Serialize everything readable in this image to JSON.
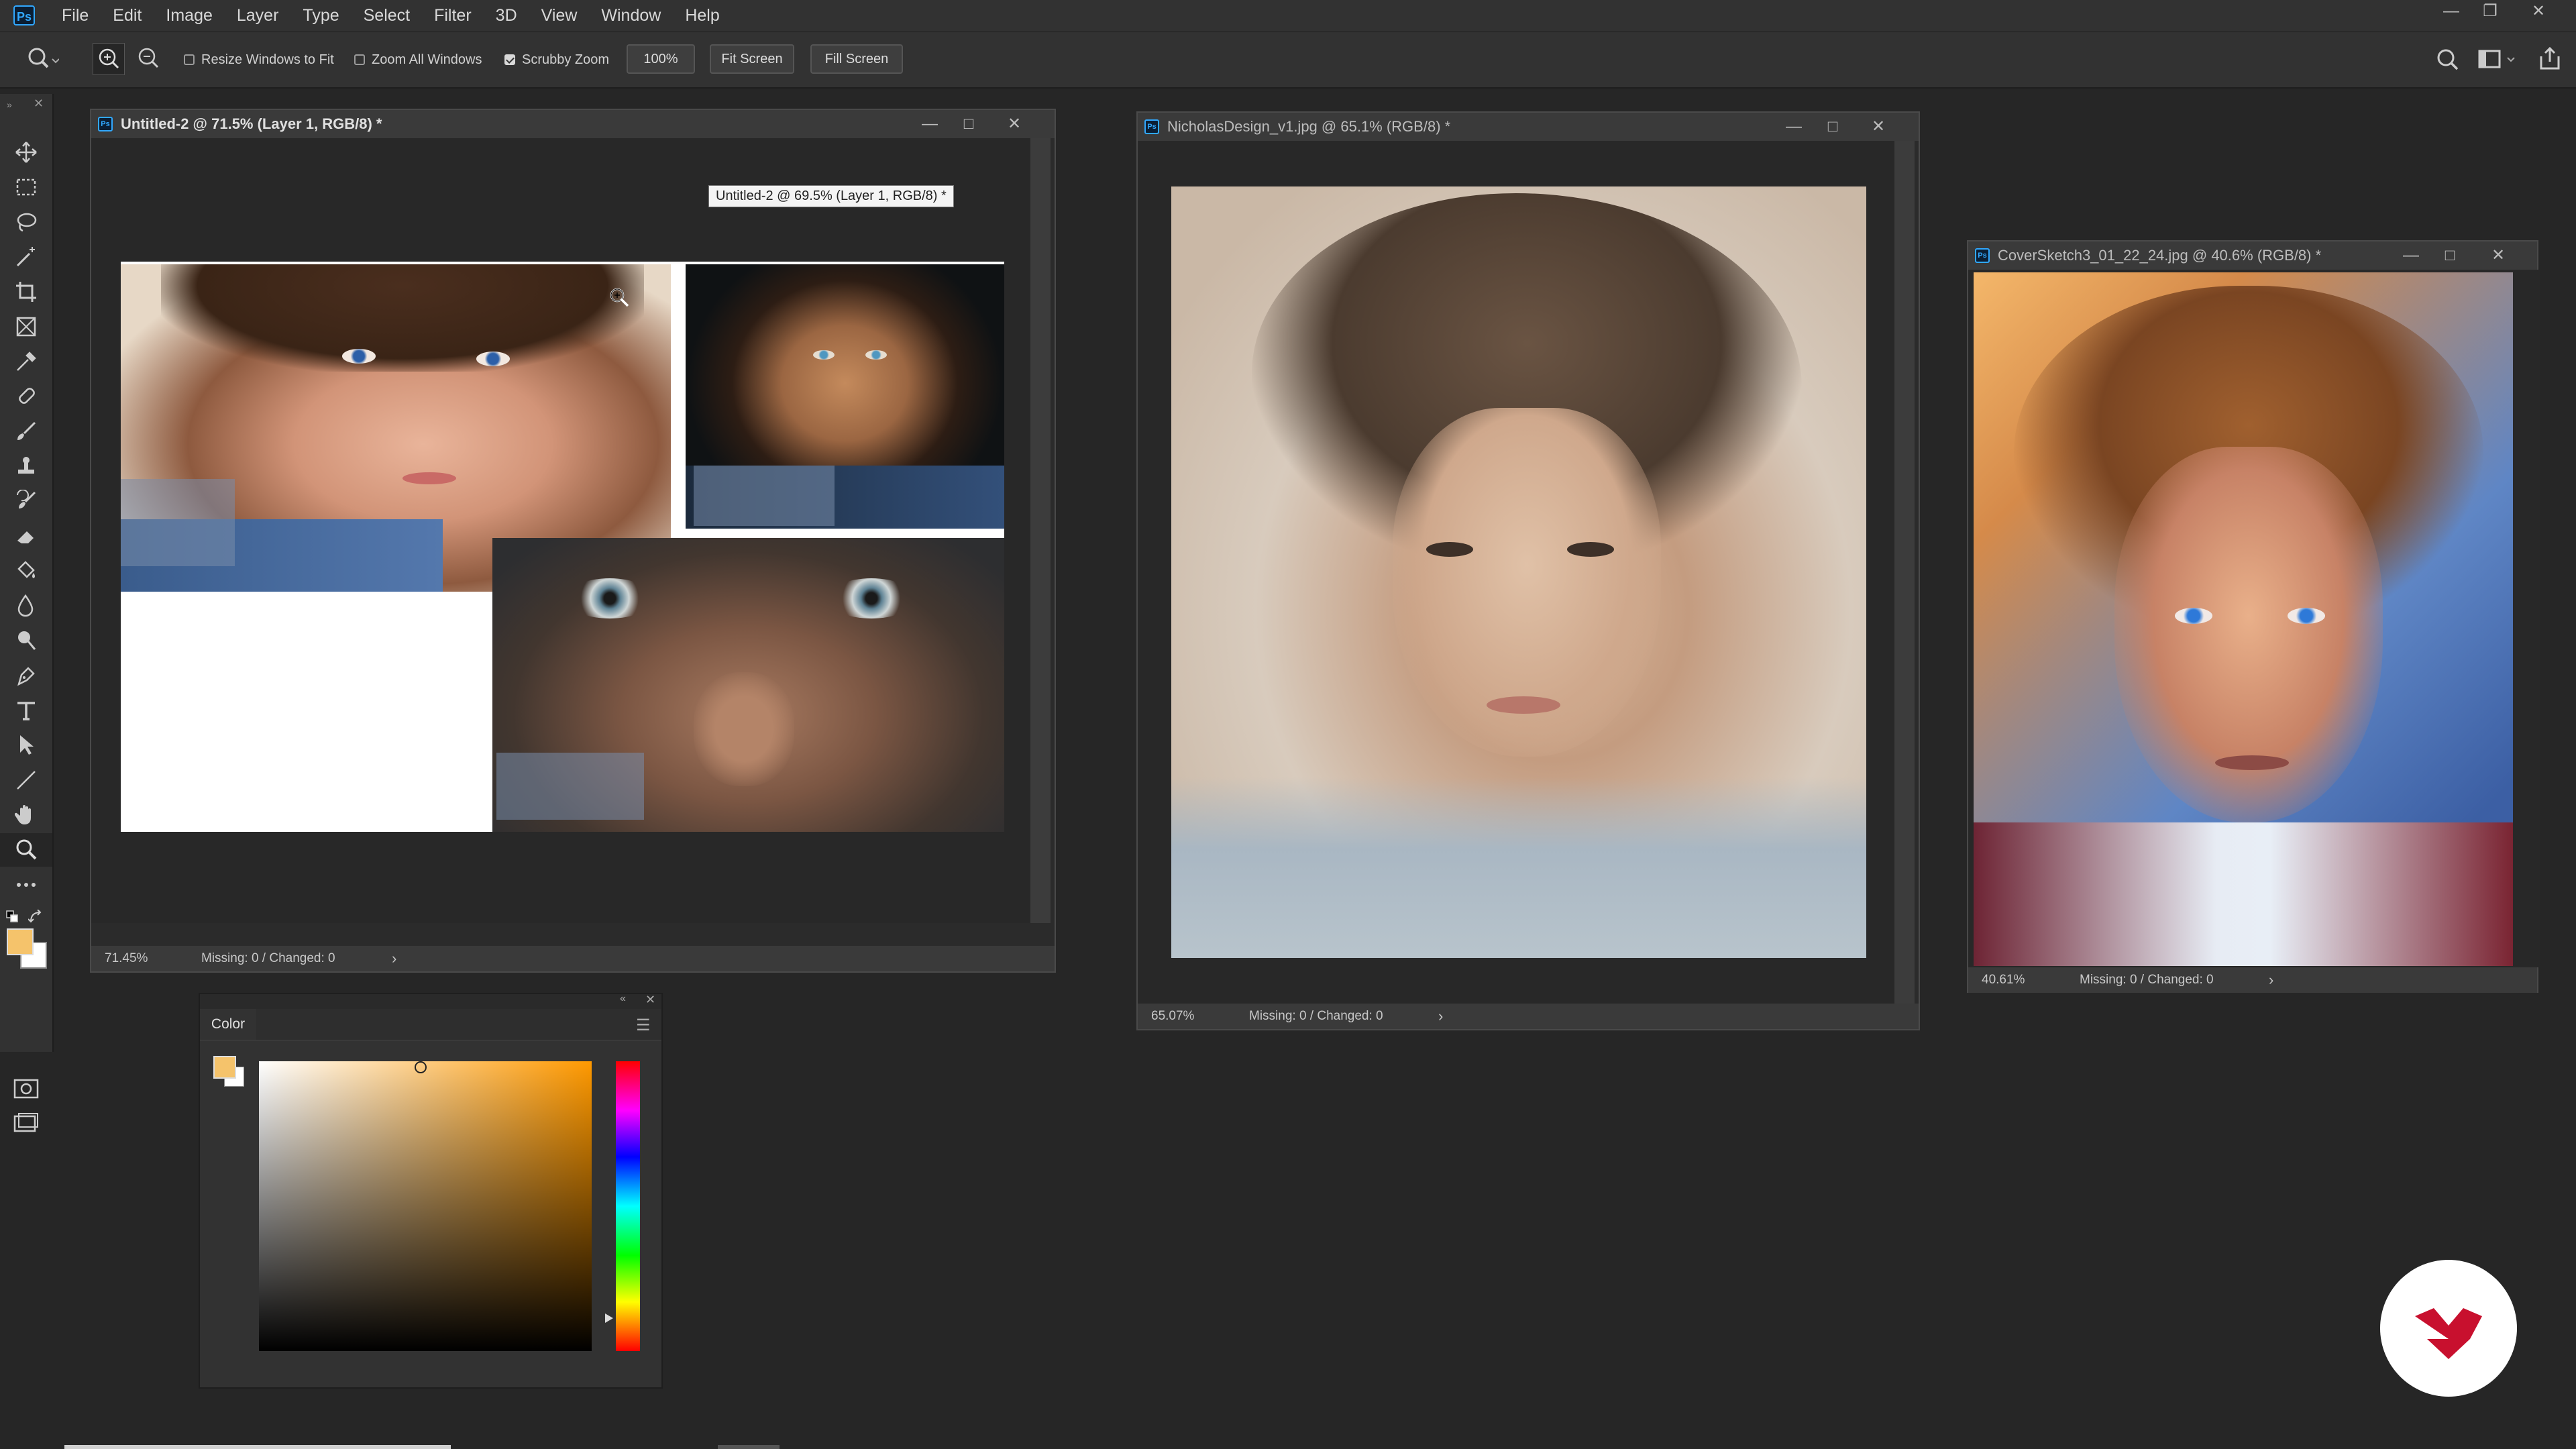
{
  "app": {
    "logo_text": "Ps"
  },
  "menubar": {
    "items": [
      "File",
      "Edit",
      "Image",
      "Layer",
      "Type",
      "Select",
      "Filter",
      "3D",
      "View",
      "Window",
      "Help"
    ]
  },
  "options": {
    "resize_windows": "Resize Windows to Fit",
    "zoom_all": "Zoom All Windows",
    "scrubby_zoom": "Scrubby Zoom",
    "zoom_value": "100%",
    "fit_screen": "Fit Screen",
    "fill_screen": "Fill Screen",
    "resize_checked": false,
    "zoom_all_checked": false,
    "scrubby_checked": true
  },
  "doc1": {
    "title": "Untitled-2 @ 71.5% (Layer 1, RGB/8) *",
    "tooltip": "Untitled-2 @ 69.5% (Layer 1, RGB/8) *",
    "zoom": "71.45%",
    "status": "Missing: 0 / Changed: 0"
  },
  "doc2": {
    "title": "NicholasDesign_v1.jpg @ 65.1% (RGB/8) *",
    "zoom": "65.07%",
    "status": "Missing: 0 / Changed: 0"
  },
  "doc3": {
    "title": "CoverSketch3_01_22_24.jpg @ 40.6% (RGB/8) *",
    "zoom": "40.61%",
    "status": "Missing: 0 / Changed: 0"
  },
  "color_panel": {
    "title": "Color",
    "foreground": "#f5c36b",
    "hue_color": "#ff9900"
  },
  "colors": {
    "accent": "#31a8ff",
    "brand_badge": "#c8102e"
  },
  "icons": [
    "move-icon",
    "marquee-icon",
    "lasso-icon",
    "magic-wand-icon",
    "crop-icon",
    "frame-icon",
    "eyedropper-icon",
    "healing-icon",
    "brush-icon",
    "stamp-icon",
    "history-brush-icon",
    "eraser-icon",
    "paint-bucket-icon",
    "blur-icon",
    "dodge-icon",
    "pen-icon",
    "type-icon",
    "path-select-icon",
    "line-icon",
    "hand-icon",
    "zoom-icon",
    "more-icon"
  ]
}
